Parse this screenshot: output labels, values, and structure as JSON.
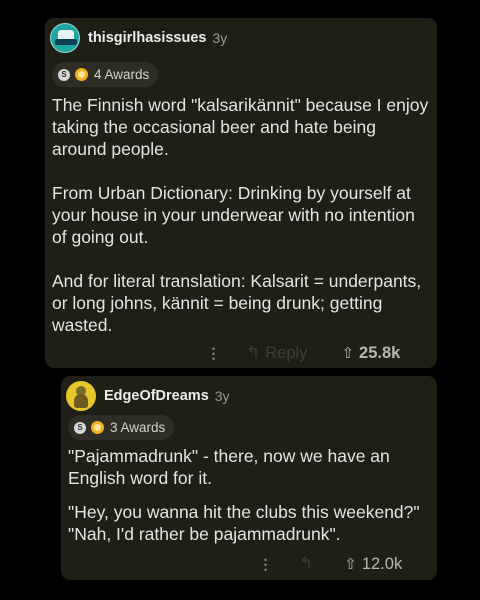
{
  "comments": [
    {
      "username": "thisgirlhasissues",
      "age": "3y",
      "awards": "4 Awards",
      "body": [
        "The Finnish word \"kalsarikännit\" because I enjoy taking the occasional beer and hate being around people.",
        "From Urban Dictionary: Drinking by yourself at your house in your underwear with no intention of going out.",
        "And for literal translation: Kalsarit = underpants, or long johns, kännit = being drunk; getting wasted."
      ],
      "more": "⋮",
      "reply_label": "Reply",
      "votes": "25.8k"
    },
    {
      "username": "EdgeOfDreams",
      "age": "3y",
      "awards": "3 Awards",
      "body": [
        "\"Pajammadrunk\" - there, now we have an English word for it.",
        "\"Hey, you wanna hit the clubs this weekend?\" \"Nah, I'd rather be pajammadrunk\"."
      ],
      "more": "⋮",
      "votes": "12.0k"
    }
  ],
  "icons": {
    "silver_award": "S",
    "reply": "↰",
    "upvote": "⇧"
  },
  "colors": {
    "card_background": "#1f1f16",
    "page_background": "#000000",
    "avatar1": "#1fa7a2",
    "avatar2": "#e5c62b",
    "gold_award": "#f2b21f"
  }
}
